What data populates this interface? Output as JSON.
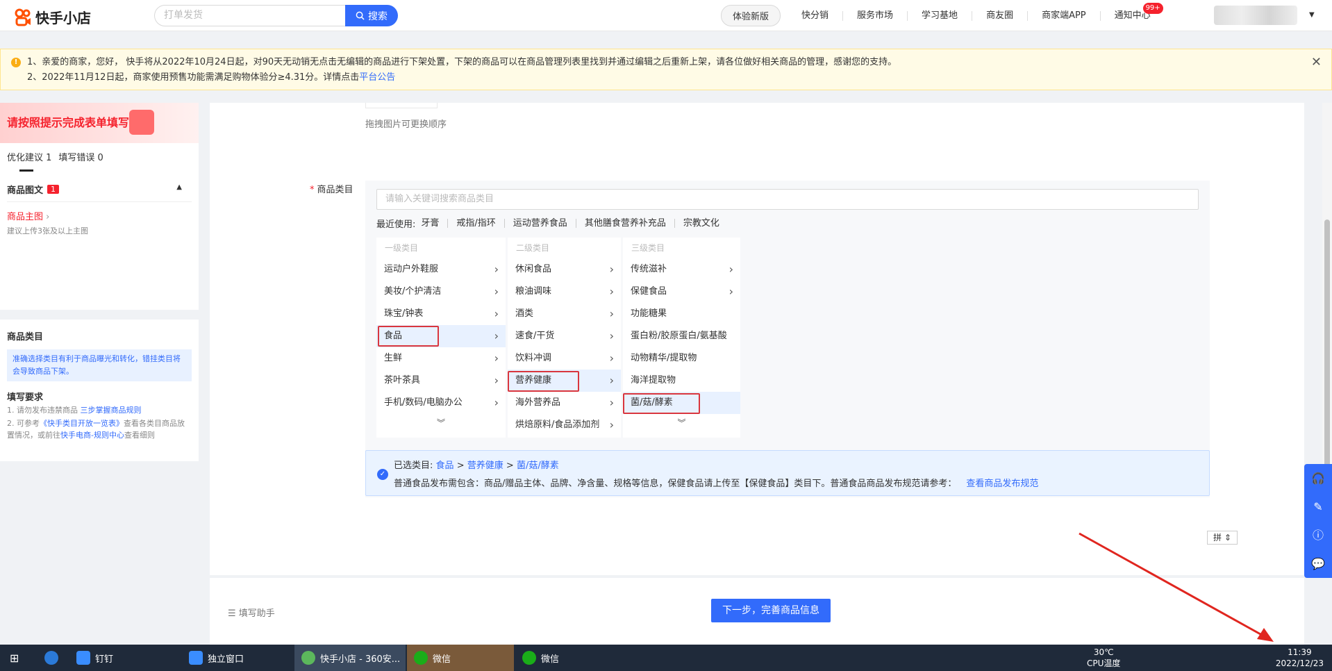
{
  "topbar": {
    "logo_text": "快手小店",
    "search_placeholder": "打单发货",
    "search_button": "搜索",
    "nav": [
      "体验新版",
      "快分销",
      "服务市场",
      "学习基地",
      "商友圈",
      "商家端APP",
      "通知中心"
    ],
    "notify_badge": "99+"
  },
  "notice": {
    "line1": "1、亲爱的商家，您好， 快手将从2022年10月24日起，对90天无动销无点击无编辑的商品进行下架处置，下架的商品可以在商品管理列表里找到并通过编辑之后重新上架，请各位做好相关商品的管理，感谢您的支持。",
    "line2_prefix": "2、2022年11月12日起，商家使用预售功能需满足购物体验分≥4.31分。详情点击",
    "line2_link": "平台公告"
  },
  "left_panel": {
    "header": "请按照提示完成表单填写",
    "tab_optimize": "优化建议 1",
    "tab_errors": "填写错误 0",
    "section_title": "商品图文",
    "section_badge": "1",
    "sub_link": "商品主图",
    "sub_hint": "建议上传3张及以上主图",
    "cat_title": "商品类目",
    "cat_info": "准确选择类目有利于商品曝光和转化，错挂类目将会导致商品下架。",
    "req_title": "填写要求",
    "req1_prefix": "1. 请勿发布违禁商品 ",
    "req1_link": "三步掌握商品规则",
    "req2_prefix": "2. 可参考",
    "req2_link1": "《快手类目开放一览表》",
    "req2_mid": "查看各类目商品放置情况，或前往",
    "req2_link2": "快手电商-规则中心",
    "req2_suffix": "查看细则"
  },
  "form": {
    "drag_hint": "拖拽图片可更换顺序",
    "category_label": "商品类目",
    "cat_search_placeholder": "请输入关键词搜索商品类目",
    "recent_label": "最近使用:",
    "recent": [
      "牙膏",
      "戒指/指环",
      "运动营养食品",
      "其他膳食营养补充品",
      "宗教文化"
    ],
    "col1_head": "一级类目",
    "col1": [
      "运动户外鞋服",
      "美妆/个护清洁",
      "珠宝/钟表",
      "食品",
      "生鲜",
      "茶叶茶具",
      "手机/数码/电脑办公"
    ],
    "col2_head": "二级类目",
    "col2": [
      "休闲食品",
      "粮油调味",
      "酒类",
      "速食/干货",
      "饮料冲调",
      "营养健康",
      "海外营养品",
      "烘焙原料/食品添加剂"
    ],
    "col3_head": "三级类目",
    "col3": [
      "传统滋补",
      "保健食品",
      "功能糖果",
      "蛋白粉/胶原蛋白/氨基酸",
      "动物精华/提取物",
      "海洋提取物",
      "菌/菇/酵素"
    ],
    "selected_label": "已选类目:",
    "selected_path": [
      "食品",
      "营养健康",
      "菌/菇/酵素"
    ],
    "sep": ">",
    "selected_note": "普通食品发布需包含：商品/赠品主体、品牌、净含量、规格等信息，保健食品请上传至【保健食品】类目下。普通食品商品发布规范请参考：",
    "selected_note_link": "查看商品发布规范",
    "ime": "拼"
  },
  "bottom": {
    "helper": "填写助手",
    "next_button": "下一步，完善商品信息"
  },
  "taskbar": {
    "items": [
      "钉钉",
      "独立窗口",
      "快手小店 - 360安...",
      "微信",
      "微信"
    ],
    "temp": "30℃",
    "cpu": "CPU温度",
    "time": "11:39",
    "date": "2022/12/23"
  },
  "colors": {
    "accent": "#326bfb",
    "alert": "#f5222d",
    "highlight_border": "#d9363e",
    "notice_bg": "#fffbe6"
  }
}
